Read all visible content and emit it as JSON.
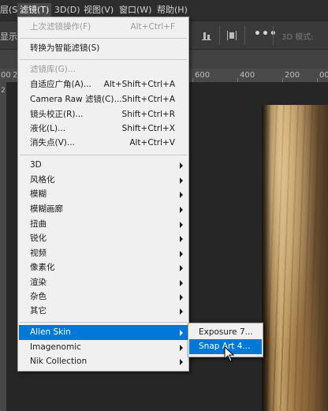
{
  "menubar": {
    "items": [
      "层(S)",
      "滤镜(T)",
      "3D(D)",
      "视图(V)",
      "窗口(W)",
      "帮助(H)"
    ],
    "active_index": 1
  },
  "optbar": {
    "left_text": "显示",
    "more_label": "•••",
    "mode_3d_label": "3D 模式:"
  },
  "ruler": {
    "numbers": [
      "00",
      "20",
      "600",
      "400",
      "200",
      "00"
    ],
    "left_number": "2"
  },
  "filter_menu": {
    "items": [
      {
        "label": "上次滤镜操作(F)",
        "shortcut": "Alt+Ctrl+F",
        "disabled": true
      },
      {
        "label": "转换为智能滤镜(S)",
        "shortcut": ""
      },
      {
        "label": "滤镜库(G)...",
        "shortcut": "",
        "disabled": true
      },
      {
        "label": "自适应广角(A)...",
        "shortcut": "Alt+Shift+Ctrl+A"
      },
      {
        "label": "Camera Raw 滤镜(C)...",
        "shortcut": "Shift+Ctrl+A"
      },
      {
        "label": "镜头校正(R)...",
        "shortcut": "Shift+Ctrl+R"
      },
      {
        "label": "液化(L)...",
        "shortcut": "Shift+Ctrl+X"
      },
      {
        "label": "消失点(V)...",
        "shortcut": "Alt+Ctrl+V"
      },
      {
        "label": "3D",
        "submenu": true
      },
      {
        "label": "风格化",
        "submenu": true
      },
      {
        "label": "模糊",
        "submenu": true
      },
      {
        "label": "模糊画廊",
        "submenu": true
      },
      {
        "label": "扭曲",
        "submenu": true
      },
      {
        "label": "锐化",
        "submenu": true
      },
      {
        "label": "视频",
        "submenu": true
      },
      {
        "label": "像素化",
        "submenu": true
      },
      {
        "label": "渲染",
        "submenu": true
      },
      {
        "label": "杂色",
        "submenu": true
      },
      {
        "label": "其它",
        "submenu": true
      },
      {
        "label": "Alien Skin",
        "submenu": true,
        "highlighted": true
      },
      {
        "label": "Imagenomic",
        "submenu": true
      },
      {
        "label": "Nik Collection",
        "submenu": true
      }
    ]
  },
  "alien_skin_submenu": {
    "items": [
      {
        "label": "Exposure 7..."
      },
      {
        "label": "Snap Art 4...",
        "highlighted": true
      }
    ]
  },
  "colors": {
    "highlight": "#0078d7",
    "menu_bg": "#f0f0f0",
    "app_bg": "#2b2b2b"
  }
}
